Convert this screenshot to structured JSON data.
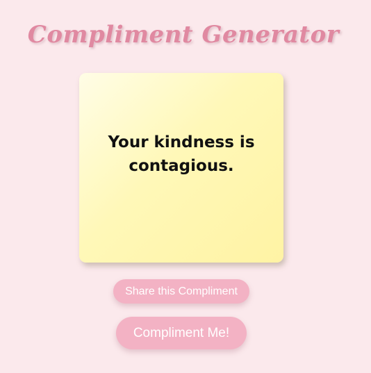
{
  "header": {
    "title": "Compliment Generator"
  },
  "card": {
    "compliment": "Your kindness is contagious."
  },
  "actions": {
    "share_label": "Share this Compliment",
    "generate_label": "Compliment Me!"
  },
  "colors": {
    "background": "#fbe9ec",
    "title": "#e089a1",
    "card": "#fff6b0",
    "button": "#f3b2c4",
    "button_text": "#ffffff"
  }
}
